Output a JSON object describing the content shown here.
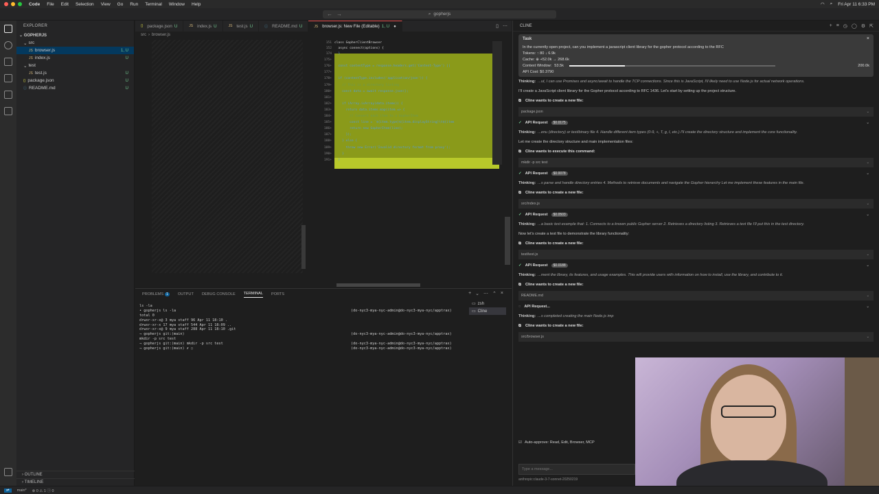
{
  "menubar": {
    "app": "Code",
    "items": [
      "File",
      "Edit",
      "Selection",
      "View",
      "Go",
      "Run",
      "Terminal",
      "Window",
      "Help"
    ],
    "datetime": "Fri Apr 11 6:33 PM"
  },
  "command_center": {
    "text": "gopherjs"
  },
  "sidebar": {
    "title": "EXPLORER",
    "project": "GOPHERJS",
    "tree": [
      {
        "label": "src",
        "indent": 0,
        "kind": "folder",
        "status": ""
      },
      {
        "label": "browser.js",
        "indent": 1,
        "kind": "js",
        "status": "1, U"
      },
      {
        "label": "index.js",
        "indent": 1,
        "kind": "js",
        "status": "U"
      },
      {
        "label": "test",
        "indent": 0,
        "kind": "folder",
        "status": ""
      },
      {
        "label": "test.js",
        "indent": 1,
        "kind": "js",
        "status": "U"
      },
      {
        "label": "package.json",
        "indent": 0,
        "kind": "json",
        "status": "U"
      },
      {
        "label": "README.md",
        "indent": 0,
        "kind": "md",
        "status": "U"
      }
    ],
    "outline": "OUTLINE",
    "timeline": "TIMELINE"
  },
  "tabs": [
    {
      "label": "package.json",
      "status": "U",
      "active": false
    },
    {
      "label": "index.js",
      "status": "U",
      "active": false
    },
    {
      "label": "test.js",
      "status": "U",
      "active": false
    },
    {
      "label": "README.md",
      "status": "U",
      "active": false
    },
    {
      "label": "browser.js: New File (Editable)",
      "status": "1, U",
      "active": true
    }
  ],
  "breadcrumb": [
    "src",
    "browser.js"
  ],
  "code": {
    "header": [
      {
        "n": "151",
        "text": "class GopherClientBrowser"
      },
      {
        "n": "152",
        "text": "  async connect(options) {"
      }
    ],
    "lines": [
      {
        "n": "174",
        "text": "  }"
      },
      {
        "n": "175+",
        "text": ""
      },
      {
        "n": "176+",
        "text": "  const contentType = response.headers.get('Content-Type') ||"
      },
      {
        "n": "177+",
        "text": ""
      },
      {
        "n": "178+",
        "text": "  if (contentType.includes('application/json')) {"
      },
      {
        "n": "179+",
        "text": "    // This is a directory listing"
      },
      {
        "n": "180+",
        "text": "    const data = await response.json();"
      },
      {
        "n": "181+",
        "text": ""
      },
      {
        "n": "182+",
        "text": "    if (Array.isArray(data.items)) {"
      },
      {
        "n": "183+",
        "text": "      return data.items.map(item => {"
      },
      {
        "n": "184+",
        "text": "        // Convert each item to a GopherItem"
      },
      {
        "n": "185+",
        "text": "        const line = `${item.type}${item.displayString}\\t${item"
      },
      {
        "n": "186+",
        "text": "        return new GopherItem(line);"
      },
      {
        "n": "187+",
        "text": "      });"
      },
      {
        "n": "188+",
        "text": "    } else {"
      },
      {
        "n": "189+",
        "text": "      throw new Error('Invalid directory format from proxy');"
      },
      {
        "n": "190+",
        "text": "    }"
      },
      {
        "n": "191+",
        "text": "  }"
      }
    ]
  },
  "panel": {
    "tabs": [
      "PROBLEMS",
      "OUTPUT",
      "DEBUG CONSOLE",
      "TERMINAL",
      "PORTS"
    ],
    "problems_count": "1",
    "terminal_lines": [
      {
        "left": "ls -la",
        "right": ""
      },
      {
        "left": "• gopherjs ls -la",
        "right": "(do-nyc3-mya-nyc-admin@do-nyc3-mya-nyc/apptrax)"
      },
      {
        "left": "total 0",
        "right": ""
      },
      {
        "left": "drwxr-xr-x@  3 mya  staff   96 Apr 11 18:10 .",
        "right": ""
      },
      {
        "left": "drwxr-xr-x  17 mya  staff  544 Apr 11 18:09 ..",
        "right": ""
      },
      {
        "left": "drwxr-xr-x@  9 mya  staff  288 Apr 11 18:10 .git",
        "right": ""
      },
      {
        "left": "→ gopherjs git:(main)",
        "right": "(do-nyc3-mya-nyc-admin@do-nyc3-mya-nyc/apptrax)"
      },
      {
        "left": "mkdir -p src test",
        "right": ""
      },
      {
        "left": "→ gopherjs git:(main) mkdir -p src test",
        "right": "(do-nyc3-mya-nyc-admin@do-nyc3-mya-nyc/apptrax)"
      },
      {
        "left": "→ gopherjs git:(main) ✗ ▯",
        "right": "(do-nyc3-mya-nyc-admin@do-nyc3-mya-nyc/apptrax)"
      }
    ],
    "terminals": [
      "zsh",
      "Cline"
    ]
  },
  "cline": {
    "title": "CLINE",
    "task": {
      "label": "Task",
      "text": "In the currently open project, can you implement a javascript client library for the gopher protocol according to the RFC",
      "tokens": "Tokens: ↑ 80 ↓ 6.9k",
      "cache": "Cache: ⊕ +52.0k → 268.6k",
      "context_label": "Context Window:",
      "context_used": "53.5k",
      "context_max": "200.0k",
      "context_fill": 0.27,
      "api_cost": "API Cost: $0.3790"
    },
    "messages": [
      {
        "type": "thinking",
        "text": "...ut, I can use Promises and async/await to handle the TCP connections. Since this is JavaScript, I'll likely need to use Node.js for actual network operations."
      },
      {
        "type": "plain",
        "text": "I'll create a JavaScript client library for the Gopher protocol according to RFC 1436. Let's start by setting up the project structure."
      },
      {
        "type": "want",
        "text": "Cline wants to create a new file:"
      },
      {
        "type": "file",
        "text": "package.json"
      },
      {
        "type": "api",
        "text": "API Request",
        "cost": "$0.0175"
      },
      {
        "type": "thinking",
        "text": "...enu (directory) or text/binary file 4. Handle different item types (0-9, +, T, g, I, etc.) I'll create the directory structure and implement the core functionality."
      },
      {
        "type": "plain",
        "text": "Let me create the directory structure and main implementation files:"
      },
      {
        "type": "want",
        "text": "Cline wants to execute this command:"
      },
      {
        "type": "file",
        "text": "mkdir -p src test"
      },
      {
        "type": "api",
        "text": "API Request",
        "cost": "$0.0078"
      },
      {
        "type": "thinking",
        "text": "...s parse and handle directory entries 4. Methods to retrieve documents and navigate the Gopher hierarchy Let me implement these features in the main file."
      },
      {
        "type": "want",
        "text": "Cline wants to create a new file:"
      },
      {
        "type": "file",
        "text": "src/index.js"
      },
      {
        "type": "api",
        "text": "API Request",
        "cost": "$0.0503"
      },
      {
        "type": "thinking",
        "text": "...a basic test example that: 1. Connects to a known public Gopher server 2. Retrieves a directory listing 3. Retrieves a text file I'll put this in the test directory."
      },
      {
        "type": "plain",
        "text": "Now let's create a test file to demonstrate the library functionality:"
      },
      {
        "type": "want",
        "text": "Cline wants to create a new file:"
      },
      {
        "type": "file",
        "text": "test/test.js"
      },
      {
        "type": "api",
        "text": "API Request",
        "cost": "$0.0188"
      },
      {
        "type": "thinking",
        "text": "...ment the library, its features, and usage examples. This will provide users with information on how to install, use the library, and contribute to it."
      },
      {
        "type": "want",
        "text": "Cline wants to create a new file:"
      },
      {
        "type": "file",
        "text": "README.md"
      },
      {
        "type": "api",
        "text": "API Request...",
        "cost": ""
      },
      {
        "type": "thinking",
        "text": "...s completed creating the main Node.js imp"
      },
      {
        "type": "want",
        "text": "Cline wants to create a new file:"
      },
      {
        "type": "file",
        "text": "src/browser.js"
      }
    ],
    "auto_approve": "Auto-approve: Read, Edit, Browser, MCP",
    "input_placeholder": "Type a message...",
    "model": "anthropic:claude-3-7-sonnet-20250219"
  },
  "statusbar": {
    "branch": "main*",
    "problems": "⊗ 0 ⚠ 1 ⓘ 0"
  }
}
